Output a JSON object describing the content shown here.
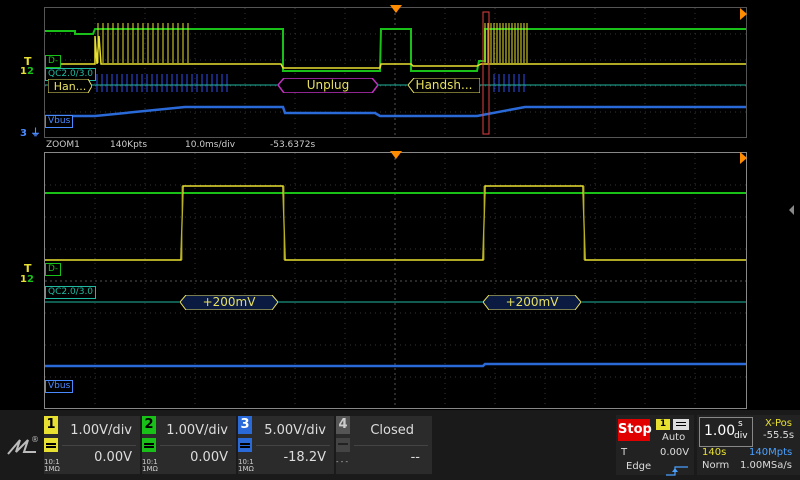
{
  "colors": {
    "ch1": "#e8e030",
    "ch2": "#18c018",
    "ch3": "#2a6ad8",
    "bus": "#20b8a0",
    "stop": "#e00000",
    "accent": "#ff8c00"
  },
  "labels": {
    "d_minus": "D-",
    "qc": "QC2.0/3.0",
    "vbus": "Vbus"
  },
  "markers": {
    "trigger": "T",
    "ch1": "1",
    "ch2": "2",
    "ch3": "3"
  },
  "top_bus": {
    "seg_left": "Han...",
    "seg_mid": "Unplug",
    "seg_right": "Handsh..."
  },
  "zoom_info": {
    "name": "ZOOM1",
    "points": "140Kpts",
    "timebase": "10.0ms/div",
    "position": "-53.6372s"
  },
  "zoom_bus": {
    "seg1": "+200mV",
    "seg2": "+200mV"
  },
  "channels": [
    {
      "num": "1",
      "scale": "1.00V/div",
      "offset": "0.00V",
      "imp1": "10:1",
      "imp2": "1MΩ"
    },
    {
      "num": "2",
      "scale": "1.00V/div",
      "offset": "0.00V",
      "imp1": "10:1",
      "imp2": "1MΩ"
    },
    {
      "num": "3",
      "scale": "5.00V/div",
      "offset": "-18.2V",
      "imp1": "10:1",
      "imp2": "1MΩ"
    },
    {
      "num": "4",
      "scale": "Closed",
      "offset": "--",
      "imp1": "- - -",
      "imp2": ""
    }
  ],
  "trigger": {
    "state": "Stop",
    "source": "1",
    "mode": "Auto",
    "t_label": "T",
    "level": "0.00V",
    "type": "Edge"
  },
  "timebase": {
    "scale": "1.00",
    "unit_top": "s",
    "unit_bottom": "div",
    "xpos_label": "X-Pos",
    "xpos": "-55.5s",
    "length": "140s",
    "mpts": "140Mpts",
    "acq": "Norm",
    "rate": "1.00MSa/s"
  }
}
